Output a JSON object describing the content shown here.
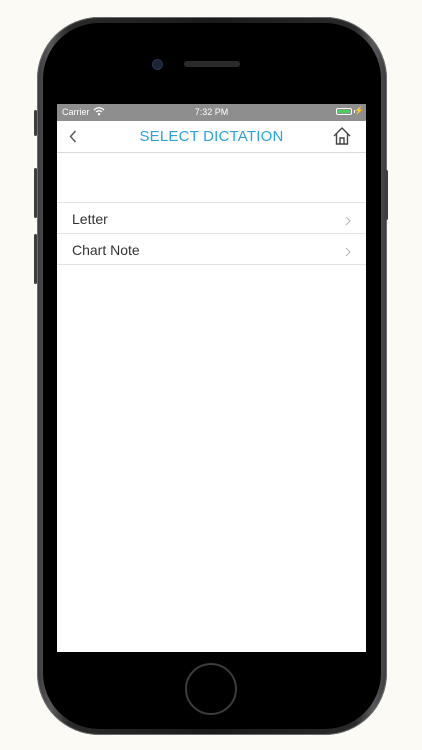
{
  "status_bar": {
    "carrier": "Carrier",
    "time": "7:32 PM",
    "battery_level": 1.0,
    "battery_color": "#49d35a",
    "charging_icon": "bolt-icon",
    "charging_glyph": "⚡"
  },
  "nav": {
    "title": "SELECT DICTATION",
    "title_color": "#2aa3d8",
    "back_icon": "chevron-left-icon",
    "home_icon": "home-icon"
  },
  "list": {
    "items": [
      {
        "label": "Letter",
        "icon": "chevron-right-icon"
      },
      {
        "label": "Chart Note",
        "icon": "chevron-right-icon"
      }
    ]
  }
}
